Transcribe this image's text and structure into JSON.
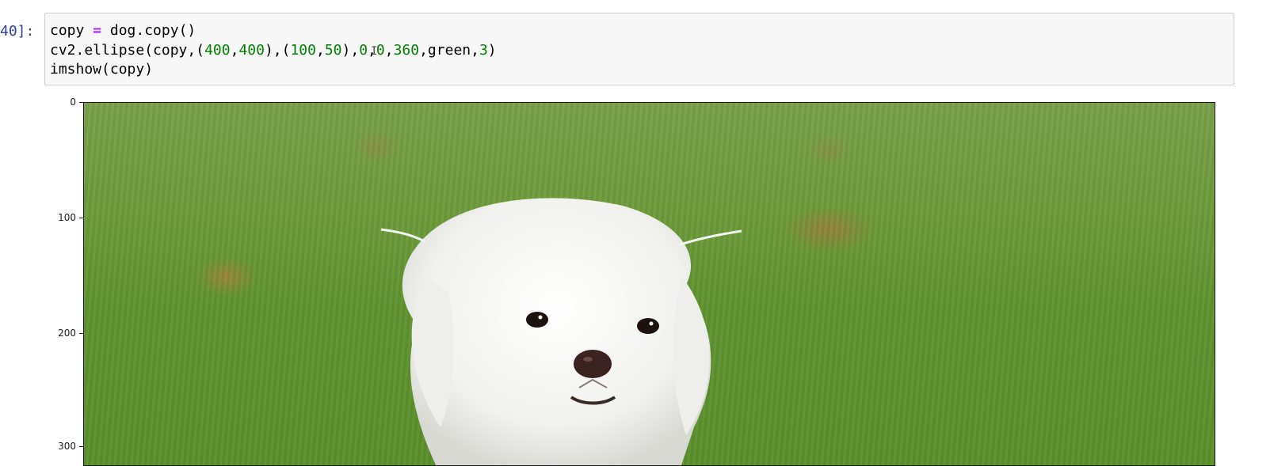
{
  "cell": {
    "prompt": "40]:",
    "code_lines": [
      [
        {
          "t": "copy ",
          "c": "plain"
        },
        {
          "t": "=",
          "c": "op"
        },
        {
          "t": " dog.copy()",
          "c": "plain"
        }
      ],
      [
        {
          "t": "cv2.ellipse(copy,(",
          "c": "plain"
        },
        {
          "t": "400",
          "c": "num"
        },
        {
          "t": ",",
          "c": "plain"
        },
        {
          "t": "400",
          "c": "num"
        },
        {
          "t": "),(",
          "c": "plain"
        },
        {
          "t": "100",
          "c": "num"
        },
        {
          "t": ",",
          "c": "plain"
        },
        {
          "t": "50",
          "c": "num"
        },
        {
          "t": "),",
          "c": "plain"
        },
        {
          "t": "0",
          "c": "num"
        },
        {
          "t": ",",
          "c": "plain"
        },
        {
          "t": "0",
          "c": "num"
        },
        {
          "t": ",",
          "c": "plain"
        },
        {
          "t": "360",
          "c": "num"
        },
        {
          "t": ",green,",
          "c": "plain"
        },
        {
          "t": "3",
          "c": "num"
        },
        {
          "t": ")",
          "c": "plain"
        }
      ],
      [
        {
          "t": "imshow(copy)",
          "c": "plain"
        }
      ]
    ],
    "cursor_glyph": "I"
  },
  "output": {
    "image_subject": "white maltese dog on green grass",
    "y_ticks": [
      "0",
      "100",
      "200",
      "300"
    ]
  },
  "colors": {
    "prompt": "#303f9f",
    "keyword_op": "#aa22ff",
    "number": "#008000",
    "cell_bg": "#f7f7f7",
    "cell_border": "#cfcfcf"
  }
}
